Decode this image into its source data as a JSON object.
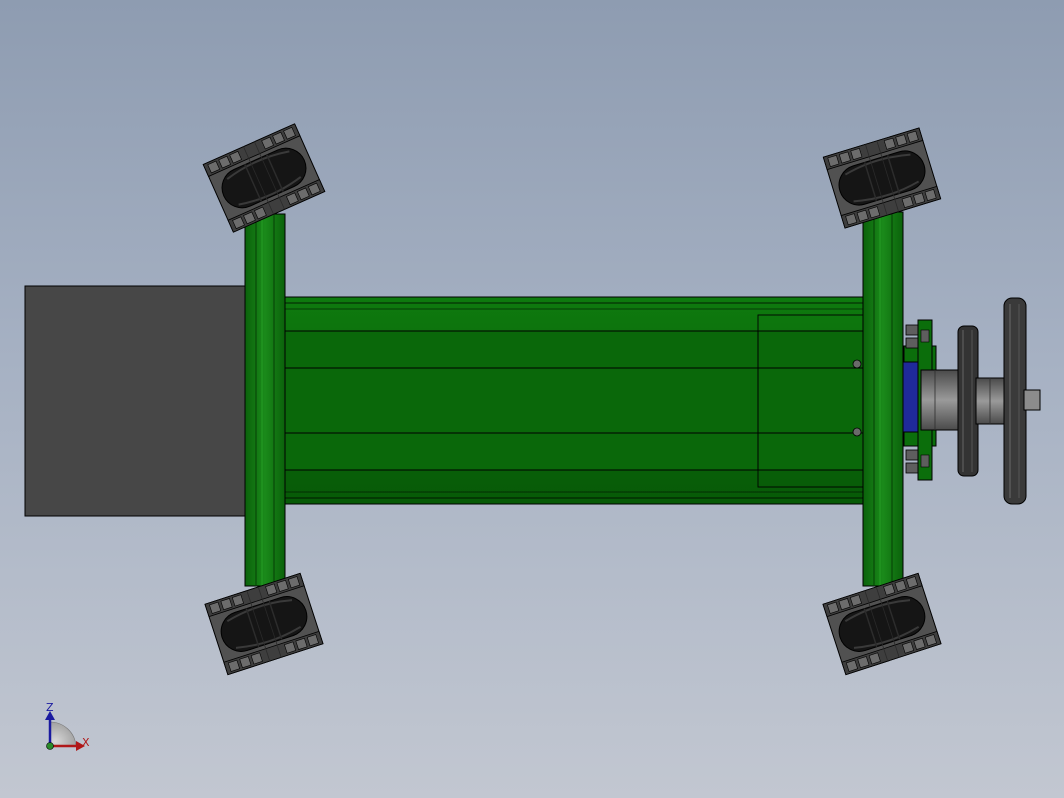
{
  "view": {
    "background_top": "#8e9cb1",
    "background_bottom": "#c2c7d1"
  },
  "colors": {
    "frame_green": "#0a6a0a",
    "frame_green_light": "#1c8a1c",
    "frame_green_dark": "#064d06",
    "motor_block": "#474747",
    "tire": "#1c1c1c",
    "hub_metal": "#6a6a6a",
    "bearing_blue": "#202a9a",
    "outline": "#000000"
  },
  "triad": {
    "z_label": "Z",
    "x_label": "X",
    "z_color": "#1a1aa0",
    "x_color": "#b01818",
    "icon": "coordinate-triad-icon"
  }
}
